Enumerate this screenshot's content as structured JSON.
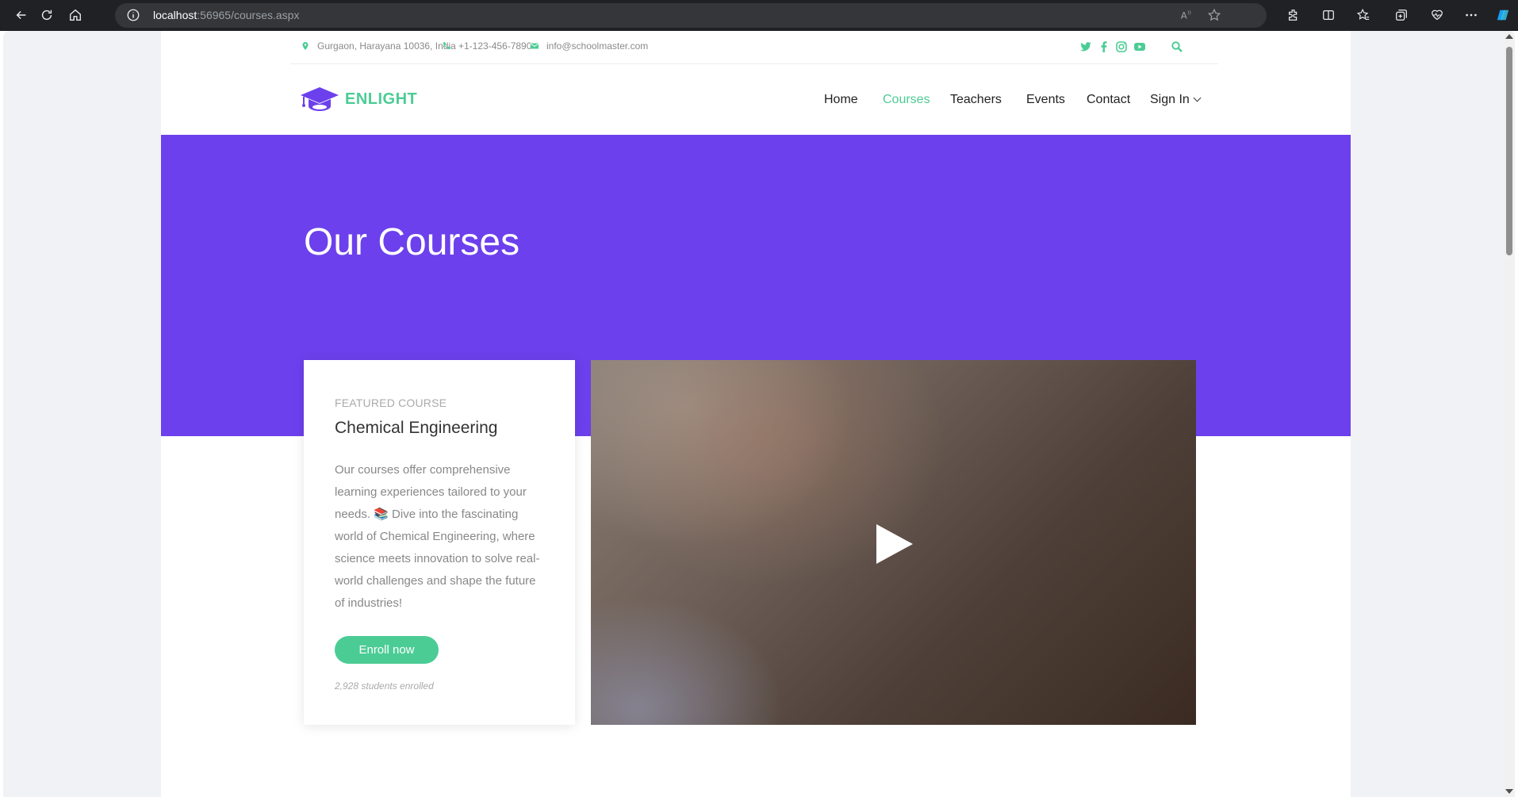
{
  "browser": {
    "url_host": "localhost",
    "url_rest": ":56965/courses.aspx"
  },
  "topbar": {
    "address": "Gurgaon, Harayana 10036, India",
    "phone": "+1-123-456-7890",
    "email": "info@schoolmaster.com",
    "social_icons": [
      "twitter-icon",
      "facebook-icon",
      "instagram-icon",
      "youtube-icon"
    ]
  },
  "header": {
    "logo_text": "ENLIGHT",
    "nav": {
      "home": "Home",
      "courses": "Courses",
      "teachers": "Teachers",
      "events": "Events",
      "contact": "Contact",
      "signin": "Sign In"
    },
    "active_item": "Courses"
  },
  "hero": {
    "title": "Our Courses"
  },
  "course": {
    "label": "FEATURED COURSE",
    "title": "Chemical Engineering",
    "description": "Our courses offer comprehensive learning experiences tailored to your needs. 📚 Dive into the fascinating world of Chemical Engineering, where science meets innovation to solve real-world challenges and shape the future of industries!",
    "button": "Enroll now",
    "enrolled": "2,928 students enrolled"
  },
  "colors": {
    "accent": "#4ccc95",
    "hero_bg": "#6c40ec"
  }
}
